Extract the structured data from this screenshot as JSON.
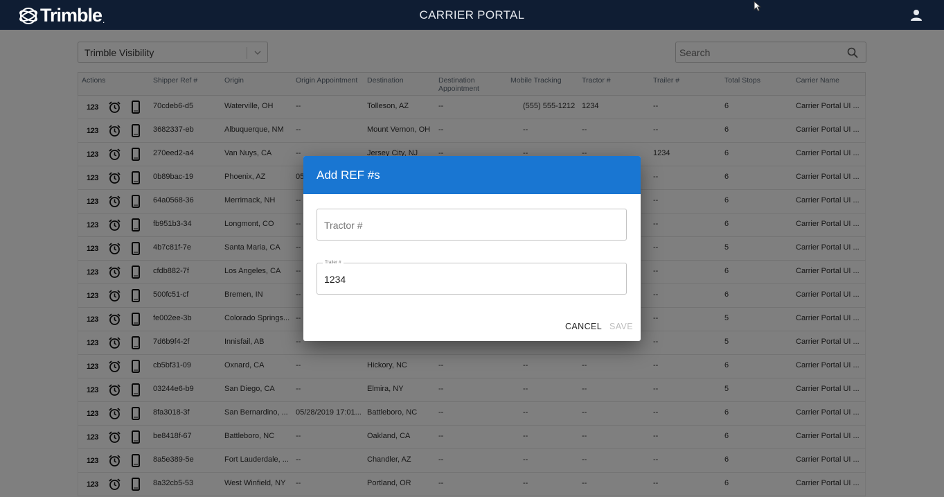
{
  "header": {
    "logo_text": "Trimble",
    "logo_mark": ".",
    "app_title": "CARRIER PORTAL"
  },
  "toolbar": {
    "view_select_value": "Trimble Visibility",
    "search_placeholder": "Search"
  },
  "table": {
    "columns": [
      "Actions",
      "Shipper Ref #",
      "Origin",
      "Origin Appointment",
      "Destination",
      "Destination Appointment",
      "Mobile Tracking",
      "Tractor #",
      "Trailer #",
      "Total Stops",
      "Carrier Name"
    ],
    "action_label": "123",
    "rows": [
      {
        "ref": "70cdeb6-d5",
        "origin": "Waterville, OH",
        "origin_appt": "--",
        "dest": "Tolleson, AZ",
        "dest_appt": "--",
        "mobile": "(555) 555-1212",
        "tractor": "1234",
        "trailer": "--",
        "stops": "6",
        "carrier": "Carrier Portal UI ..."
      },
      {
        "ref": "3682337-eb",
        "origin": "Albuquerque, NM",
        "origin_appt": "--",
        "dest": "Mount Vernon, OH",
        "dest_appt": "--",
        "mobile": "--",
        "tractor": "--",
        "trailer": "--",
        "stops": "6",
        "carrier": "Carrier Portal UI ..."
      },
      {
        "ref": "270eed2-a4",
        "origin": "Van Nuys, CA",
        "origin_appt": "--",
        "dest": "Jersey City, NJ",
        "dest_appt": "--",
        "mobile": "--",
        "tractor": "--",
        "trailer": "1234",
        "stops": "6",
        "carrier": "Carrier Portal UI ..."
      },
      {
        "ref": "0b89bac-19",
        "origin": "Phoenix, AZ",
        "origin_appt": "05",
        "dest": "",
        "dest_appt": "",
        "mobile": "",
        "tractor": "",
        "trailer": "--",
        "stops": "6",
        "carrier": "Carrier Portal UI ..."
      },
      {
        "ref": "64a0568-36",
        "origin": "Merrimack, NH",
        "origin_appt": "--",
        "dest": "",
        "dest_appt": "",
        "mobile": "",
        "tractor": "",
        "trailer": "--",
        "stops": "6",
        "carrier": "Carrier Portal UI ..."
      },
      {
        "ref": "fb951b3-34",
        "origin": "Longmont, CO",
        "origin_appt": "--",
        "dest": "",
        "dest_appt": "",
        "mobile": "",
        "tractor": "",
        "trailer": "--",
        "stops": "6",
        "carrier": "Carrier Portal UI ..."
      },
      {
        "ref": "4b7c81f-7e",
        "origin": "Santa Maria, CA",
        "origin_appt": "--",
        "dest": "",
        "dest_appt": "",
        "mobile": "",
        "tractor": "",
        "trailer": "--",
        "stops": "5",
        "carrier": "Carrier Portal UI ..."
      },
      {
        "ref": "cfdb882-7f",
        "origin": "Los Angeles, CA",
        "origin_appt": "--",
        "dest": "",
        "dest_appt": "",
        "mobile": "",
        "tractor": "",
        "trailer": "--",
        "stops": "6",
        "carrier": "Carrier Portal UI ..."
      },
      {
        "ref": "500fc51-cf",
        "origin": "Bremen, IN",
        "origin_appt": "--",
        "dest": "",
        "dest_appt": "",
        "mobile": "",
        "tractor": "",
        "trailer": "--",
        "stops": "6",
        "carrier": "Carrier Portal UI ..."
      },
      {
        "ref": "fe002ee-3b",
        "origin": "Colorado Springs...",
        "origin_appt": "--",
        "dest": "",
        "dest_appt": "",
        "mobile": "",
        "tractor": "",
        "trailer": "--",
        "stops": "5",
        "carrier": "Carrier Portal UI ..."
      },
      {
        "ref": "7d6b9f4-2f",
        "origin": "Innisfail, AB",
        "origin_appt": "--",
        "dest": "",
        "dest_appt": "",
        "mobile": "",
        "tractor": "",
        "trailer": "--",
        "stops": "5",
        "carrier": "Carrier Portal UI ..."
      },
      {
        "ref": "cb5bf31-09",
        "origin": "Oxnard, CA",
        "origin_appt": "--",
        "dest": "Hickory, NC",
        "dest_appt": "--",
        "mobile": "--",
        "tractor": "--",
        "trailer": "--",
        "stops": "6",
        "carrier": "Carrier Portal UI ..."
      },
      {
        "ref": "03244e6-b9",
        "origin": "San Diego, CA",
        "origin_appt": "--",
        "dest": "Elmira, NY",
        "dest_appt": "--",
        "mobile": "--",
        "tractor": "--",
        "trailer": "--",
        "stops": "5",
        "carrier": "Carrier Portal UI ..."
      },
      {
        "ref": "8fa3018-3f",
        "origin": "San Bernardino, ...",
        "origin_appt": "05/28/2019 17:01...",
        "dest": "Battleboro, NC",
        "dest_appt": "--",
        "mobile": "--",
        "tractor": "--",
        "trailer": "--",
        "stops": "6",
        "carrier": "Carrier Portal UI ..."
      },
      {
        "ref": "be8418f-67",
        "origin": "Battleboro, NC",
        "origin_appt": "--",
        "dest": "Oakland, CA",
        "dest_appt": "--",
        "mobile": "--",
        "tractor": "--",
        "trailer": "--",
        "stops": "6",
        "carrier": "Carrier Portal UI ..."
      },
      {
        "ref": "8a5e389-5e",
        "origin": "Fort Lauderdale, ...",
        "origin_appt": "--",
        "dest": "Chandler, AZ",
        "dest_appt": "--",
        "mobile": "--",
        "tractor": "--",
        "trailer": "--",
        "stops": "6",
        "carrier": "Carrier Portal UI ..."
      },
      {
        "ref": "8a32cb5-53",
        "origin": "West Winfield, NY",
        "origin_appt": "--",
        "dest": "Portland, OR",
        "dest_appt": "--",
        "mobile": "--",
        "tractor": "--",
        "trailer": "--",
        "stops": "6",
        "carrier": "Carrier Portal UI ..."
      }
    ]
  },
  "dialog": {
    "title": "Add REF #s",
    "tractor_placeholder": "Tractor #",
    "tractor_value": "",
    "trailer_label": "Trailer #",
    "trailer_value": "1234",
    "cancel_label": "CANCEL",
    "save_label": "SAVE"
  },
  "colors": {
    "topbar": "#0f1d33",
    "dialog_header": "#1976d2",
    "overlay": "rgba(0,0,0,0.5)"
  }
}
